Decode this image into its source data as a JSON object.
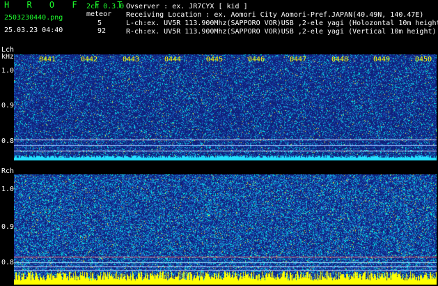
{
  "header": {
    "app_title": "H R O F F T",
    "filename": "2503230440.png",
    "datetime": "25.03.23 04:40",
    "version": "2ch 0.3.0",
    "meteor_label": "meteor",
    "meteor_counts": [
      "5",
      "92"
    ],
    "observer_line": "Ovserver            : ex. JR7CYX [ kid ]",
    "location_line": "Receiving Location : ex. Aomori City Aomori-Pref.JAPAN(40.49N, 140.47E)",
    "lch_line": "L-ch:ex. UV5R 113.900Mhz(SAPPORO VOR)USB ,2-ele yagi (Holozontal 10m height)",
    "rch_line": "R-ch:ex. UV5R 113.900Mhz(SAPPORO VOR)USB ,2-ele yagi (Vertical 10m height)"
  },
  "lch": {
    "label": "Lch",
    "unit": "kHz",
    "yticks": [
      "1.0",
      "0.9",
      "0.8"
    ],
    "time_ticks": [
      "0441",
      "0442",
      "0443",
      "0444",
      "0445",
      "0446",
      "0447",
      "0448",
      "0449",
      "0450"
    ]
  },
  "rch": {
    "label": "Rch",
    "yticks": [
      "1.0",
      "0.9",
      "0.8"
    ]
  },
  "colors": {
    "header_green": "#1dff2d",
    "tick_yellow": "#ffff00",
    "background_blue": "#1a2e8c",
    "noise_cyan": "#00e5ff",
    "signal_yellow": "#ffff00"
  }
}
